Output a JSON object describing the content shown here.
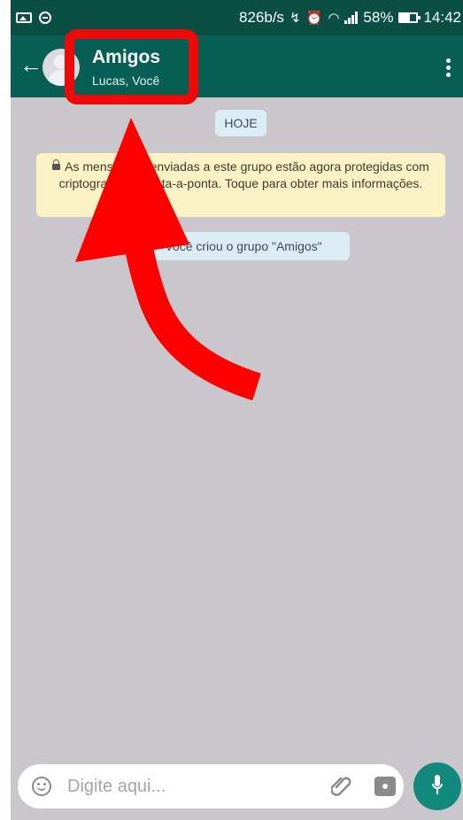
{
  "status_bar": {
    "network_speed": "826b/s",
    "battery": "58%",
    "time": "14:42"
  },
  "header": {
    "title": "Amigos",
    "subtitle": "Lucas, Você"
  },
  "chat": {
    "date_label": "HOJE",
    "encryption_notice": "As mensagens enviadas a este grupo estão agora protegidas com criptografia de ponta-a-ponta. Toque para obter mais informações.",
    "group_created": "Você criou o grupo \"Amigos\""
  },
  "input": {
    "placeholder": "Digite aqui..."
  },
  "icons": {
    "back": "back-arrow-icon",
    "avatar": "group-avatar-icon",
    "menu": "more-vert-icon",
    "emoji": "emoji-icon",
    "attach": "paperclip-icon",
    "camera": "camera-icon",
    "mic": "mic-icon",
    "lock": "lock-icon"
  },
  "colors": {
    "header": "#075e54",
    "status_bar": "#0b4f44",
    "chat_background": "#c9c7cb",
    "mic_button": "#118a7d",
    "annotation": "#ee0a0a",
    "encryption_bubble": "#fbf3c5",
    "system_bubble": "#dcecf5"
  }
}
